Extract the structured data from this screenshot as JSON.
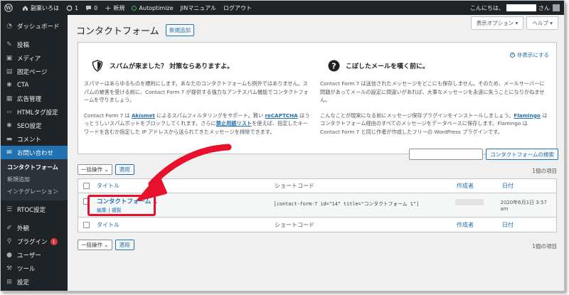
{
  "admin_bar": {
    "site_name": "副業いろは",
    "updates_count": "1",
    "comments_count": "0",
    "new_label": "新規",
    "autoptimize_label": "Autoptimize",
    "jin_manual_label": "JINマニュアル",
    "logout_label": "ログアウト",
    "greeting_prefix": "こんにちは、",
    "greeting_suffix": "さん"
  },
  "sidebar": {
    "items": [
      {
        "label": "ダッシュボード",
        "icon": "dashboard-icon"
      },
      {
        "label": "投稿",
        "icon": "pin-icon"
      },
      {
        "label": "メディア",
        "icon": "media-icon"
      },
      {
        "label": "固定ページ",
        "icon": "page-icon"
      },
      {
        "label": "CTA",
        "icon": "gear-icon"
      },
      {
        "label": "広告管理",
        "icon": "ads-icon"
      },
      {
        "label": "HTMLタグ設定",
        "icon": "code-icon"
      },
      {
        "label": "SEO設定",
        "icon": "gear-icon"
      },
      {
        "label": "コメント",
        "icon": "comment-icon"
      },
      {
        "label": "お問い合わせ",
        "icon": "mail-icon"
      }
    ],
    "submenu": [
      "コンタクトフォーム",
      "新規追加",
      "インテグレーション"
    ],
    "items_after": [
      {
        "label": "RTOC設定",
        "icon": "toc-icon"
      },
      {
        "label": "外観",
        "icon": "brush-icon"
      },
      {
        "label": "プラグイン",
        "icon": "plugin-icon",
        "badge": "1"
      },
      {
        "label": "ユーザー",
        "icon": "user-icon"
      },
      {
        "label": "ツール",
        "icon": "wrench-icon"
      },
      {
        "label": "設定",
        "icon": "settings-icon"
      }
    ]
  },
  "header": {
    "screen_options": "表示オプション ▾",
    "help": "ヘルプ ▾",
    "title": "コンタクトフォーム",
    "add_new": "新規追加"
  },
  "welcome": {
    "dismiss": "非表示にする",
    "spam": {
      "heading": "スパムが来ました？ 対策ならありますよ。",
      "p1": "スパマーはあらゆるものを標的にします。あなたのコンタクトフォームも例外ではありません。スパムの被害を受ける前に、Contact Form 7 が提供する強力なアンチスパム機能でコンタクトフォームを守りましょう。",
      "p2_a": "Contact Form 7 は ",
      "akismet": "Akismet",
      "p2_b": " によるスパムフィルタリングをサポート。賢い ",
      "recaptcha": "reCAPTCHA",
      "p2_c": " はうっとうしいスパムボットをブロックしてくれます。さらに",
      "blocklist": "禁止用語リスト",
      "p2_d": "を使えば、指定したキーワードを含むか指定した IP アドレスから送られてきたメッセージを排除できます。"
    },
    "lost": {
      "heading": "こぼしたメールを嘆く前に。",
      "p1": "Contact Form 7 は送信されたメッセージをどこにも保存しません。そのため、メールサーバーに問題があってメールの設定に間違いがあれば、大事なメッセージを永遠に失うことになりかねません。",
      "p2_a": "こんなことが現実になる前にメッセージ保存プラグインをインストールしましょう。",
      "flamingo": "Flamingo",
      "p2_b": " はコンタクトフォーム経由のすべてのメッセージをデータベースに保存します。Flamingo は Contact Form 7 と同じ作者が作成したフリーの WordPress プラグインです。"
    }
  },
  "search": {
    "button": "コンタクトフォームの検索",
    "value": ""
  },
  "tablenav": {
    "bulk": "一括操作 ⌄",
    "apply": "適用",
    "count": "1個の項目"
  },
  "table": {
    "columns": {
      "title": "タイトル",
      "shortcode": "ショートコード",
      "author": "作成者",
      "date": "日付"
    },
    "rows": [
      {
        "title": "コンタクトフォーム 1",
        "edit": "編集",
        "copy": "複製",
        "shortcode": "[contact-form-7 id=\"14\" title=\"コンタクトフォーム 1\"]",
        "date": "2020年6月1日 3:57 am"
      }
    ]
  },
  "colors": {
    "accent": "#2271b1",
    "highlight": "#e8112d",
    "admin_dark": "#1d2327"
  }
}
